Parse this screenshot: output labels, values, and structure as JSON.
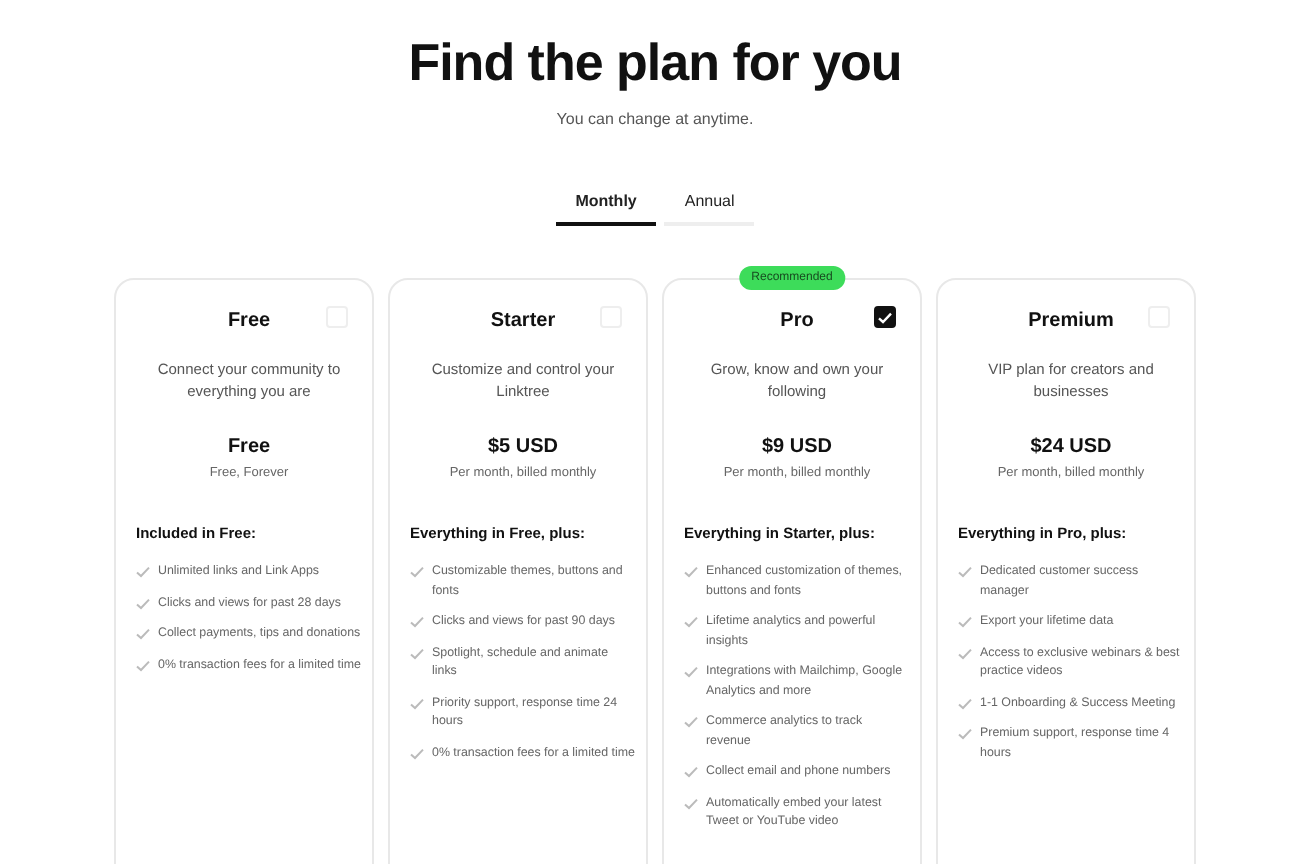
{
  "heading": "Find the plan for you",
  "subheading": "You can change at anytime.",
  "tabs": [
    {
      "label": "Monthly",
      "selected": true
    },
    {
      "label": "Annual",
      "selected": false
    }
  ],
  "plans": [
    {
      "name": "Free",
      "checked": false,
      "description": "Connect your community to everything you are",
      "price": "Free",
      "billing": "Free, Forever",
      "features_title": "Included in Free:",
      "features": [
        "Unlimited links and Link Apps",
        "Clicks and views for past 28 days",
        "Collect payments, tips and donations",
        "0% transaction fees for a limited time"
      ]
    },
    {
      "name": "Starter",
      "checked": false,
      "description": "Customize and control your Linktree",
      "price": "$5 USD",
      "billing": "Per month, billed monthly",
      "features_title": "Everything in Free, plus:",
      "features": [
        "Customizable themes, buttons and fonts",
        "Clicks and views for past 90 days",
        "Spotlight, schedule and animate links",
        "Priority support, response time 24 hours",
        "0% transaction fees for a limited time"
      ]
    },
    {
      "name": "Pro",
      "checked": true,
      "badge": "Recommended",
      "description": "Grow, know and own your following",
      "price": "$9 USD",
      "billing": "Per month, billed monthly",
      "features_title": "Everything in Starter, plus:",
      "features": [
        "Enhanced customization of themes, buttons and fonts",
        "Lifetime analytics and powerful insights",
        "Integrations with Mailchimp, Google Analytics and more",
        "Commerce analytics to track revenue",
        "Collect email and phone numbers",
        "Automatically embed your latest Tweet or YouTube video"
      ]
    },
    {
      "name": "Premium",
      "checked": false,
      "description": "VIP plan for creators and businesses",
      "price": "$24 USD",
      "billing": "Per month, billed monthly",
      "features_title": "Everything in Pro, plus:",
      "features": [
        "Dedicated customer success manager",
        "Export your lifetime data",
        "Access to exclusive webinars & best practice videos",
        "1-1 Onboarding & Success Meeting",
        "Premium support, response time 4 hours"
      ]
    }
  ]
}
